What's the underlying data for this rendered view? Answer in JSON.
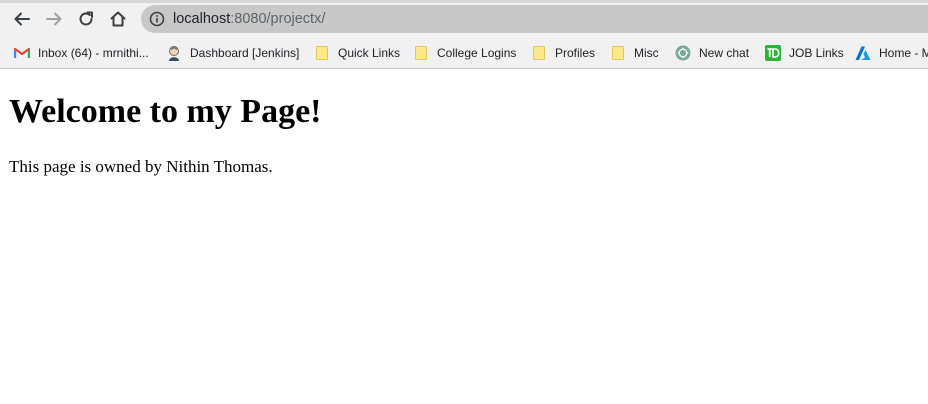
{
  "browser": {
    "url": {
      "host": "localhost",
      "rest": ":8080/projectx/"
    },
    "bookmarks": [
      {
        "label": "Inbox (64) - mrnithi...",
        "icon": "gmail-icon"
      },
      {
        "label": "Dashboard [Jenkins]",
        "icon": "jenkins-icon"
      },
      {
        "label": "Quick Links",
        "icon": "folder-icon"
      },
      {
        "label": "College Logins",
        "icon": "folder-icon"
      },
      {
        "label": "Profiles",
        "icon": "folder-icon"
      },
      {
        "label": "Misc",
        "icon": "folder-icon"
      },
      {
        "label": "New chat",
        "icon": "chatgpt-icon"
      },
      {
        "label": "JOB Links",
        "icon": "td-icon"
      },
      {
        "label": "Home - M",
        "icon": "azure-icon"
      }
    ]
  },
  "page": {
    "heading": "Welcome to my Page!",
    "owner_text": "This page is owned by Nithin Thomas."
  },
  "colors": {
    "toolbar_bg": "#f1f1f1",
    "omnibox_bg": "#c8c8c8",
    "folder": "#fde98a",
    "td_green": "#2db432",
    "azure_blue": "#0078d4",
    "gmail_red": "#ea4335"
  }
}
